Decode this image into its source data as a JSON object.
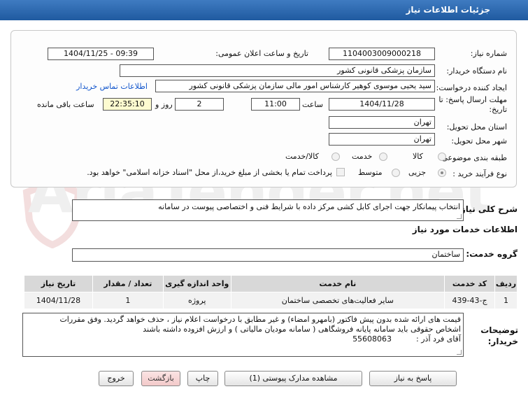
{
  "header": {
    "title": "جزئیات اطلاعات نیاز"
  },
  "form": {
    "need_number_label": "شماره نیاز:",
    "need_number": "1104003009000218",
    "announce_label": "تاریخ و ساعت اعلان عمومی:",
    "announce_value": "1404/11/25 - 09:39",
    "buyer_org_label": "نام دستگاه خریدار:",
    "buyer_org": "سازمان پزشکی قانونی کشور",
    "requester_label": "ایجاد کننده درخواست:",
    "requester": "سید یحیی موسوی کوهیر کارشناس امور مالی سازمان پزشکی قانونی کشور",
    "contact_link": "اطلاعات تماس خریدار",
    "deadline_label": "مهلت ارسال پاسخ: تا تاریخ:",
    "deadline_date": "1404/11/28",
    "time_label": "ساعت",
    "deadline_time": "11:00",
    "days_value": "2",
    "days_label": "روز و",
    "remaining_time": "22:35:10",
    "remaining_label": "ساعت باقی مانده",
    "province_label": "استان محل تحویل:",
    "province": "تهران",
    "city_label": "شهر محل تحویل:",
    "city": "تهران",
    "category_label": "طبقه بندی موضوعی:",
    "category_options": [
      "کالا",
      "خدمت",
      "کالا/خدمت"
    ],
    "process_label": "نوع فرآیند خرید :",
    "process_options": [
      "جزیی",
      "متوسط"
    ],
    "payment_note": "پرداخت تمام یا بخشی از مبلغ خرید،از محل \"اسناد خزانه اسلامی\" خواهد بود."
  },
  "summary": {
    "label": "شرح کلی نیاز:",
    "text": "انتخاب پیمانکار جهت اجرای کابل کشی مرکز داده با شرایط فنی و اختصاصی  پیوست در سامانه"
  },
  "services": {
    "section_title": "اطلاعات خدمات مورد نیاز",
    "group_label": "گروه خدمت:",
    "group_value": "ساختمان",
    "columns": [
      "ردیف",
      "کد خدمت",
      "نام خدمت",
      "واحد اندازه گیری",
      "تعداد / مقدار",
      "تاریخ نیاز"
    ],
    "rows": [
      {
        "row": "1",
        "code": "ج-43-439",
        "name": "سایر فعالیت‌های تخصصی ساختمان",
        "unit": "پروژه",
        "qty": "1",
        "date": "1404/11/28"
      }
    ]
  },
  "buyer_notes": {
    "label": "توضیحات خریدار:",
    "line1": "قیمت های ارائه شده بدون پیش فاکتور (بامهرو امضاء) و غیر مطابق با درخواست اعلام نیاز  ، حذف خواهد گردید. وفق مقررات",
    "line2": "اشخاص حقوقی باید سامانه پایانه فروشگاهی ( سامانه مودیان مالیاتی ) و ارزش افزوده  داشته باشند",
    "line3": "آقای فرد آذر :          55608063"
  },
  "buttons": {
    "reply": "پاسخ به نیاز",
    "attachments": "مشاهده مدارک پیوستی (1)",
    "print": "چاپ",
    "back": "بازگشت",
    "exit": "خروج"
  },
  "watermark": "AriaTender.net"
}
